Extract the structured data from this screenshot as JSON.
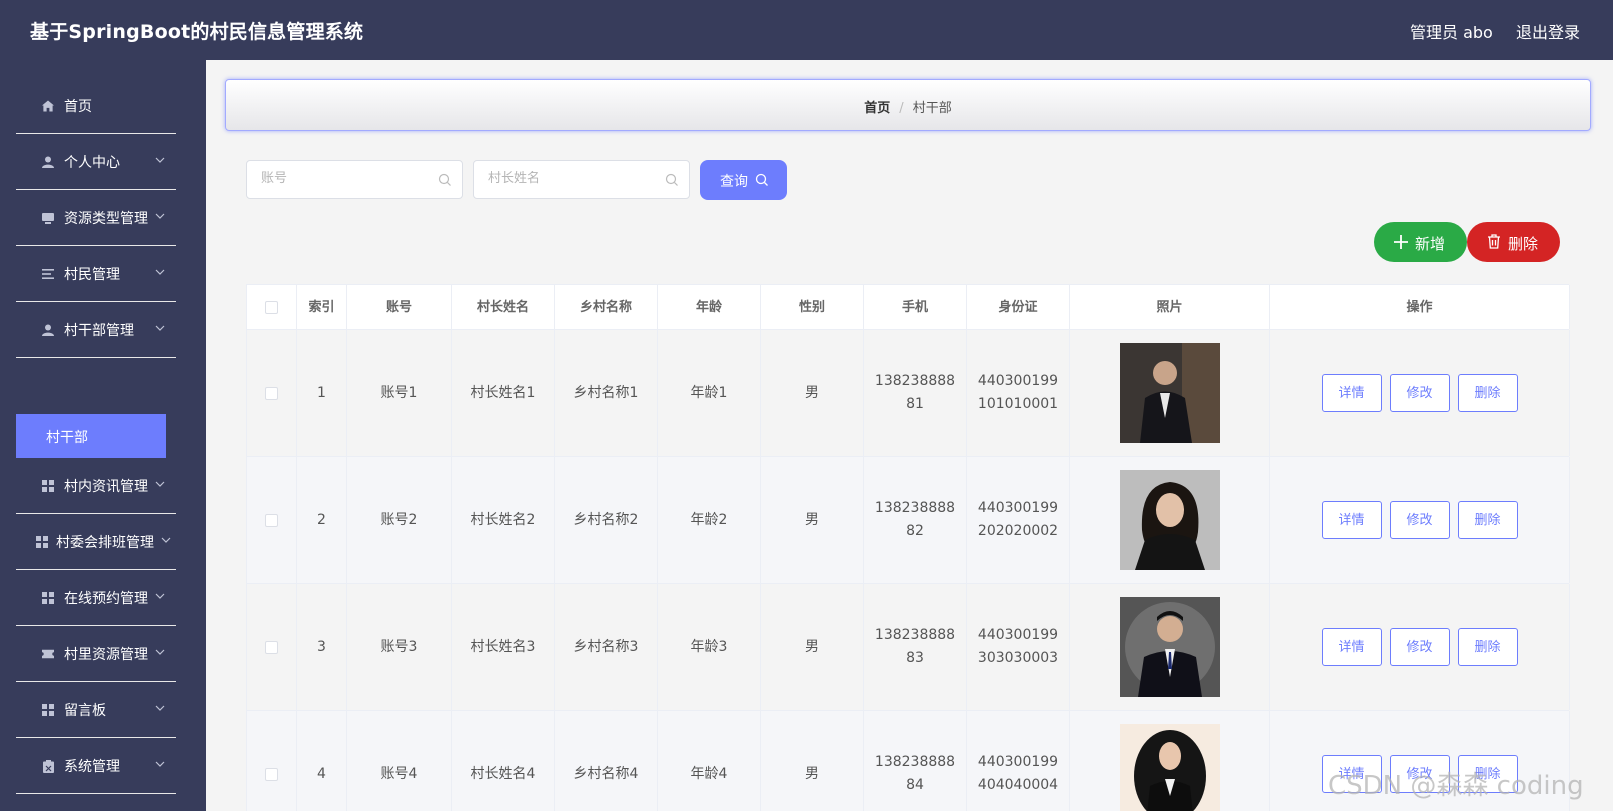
{
  "header": {
    "title": "基于SpringBoot的村民信息管理系统",
    "user": "管理员 abo",
    "logout": "退出登录"
  },
  "sidebar": {
    "items": [
      {
        "label": "首页",
        "icon": "home-icon"
      },
      {
        "label": "个人中心",
        "icon": "user-icon"
      },
      {
        "label": "资源类型管理",
        "icon": "drive-icon"
      },
      {
        "label": "村民管理",
        "icon": "list-icon"
      },
      {
        "label": "村干部管理",
        "icon": "user-icon"
      },
      {
        "label": "村内资讯管理",
        "icon": "grid-icon"
      },
      {
        "label": "村委会排班管理",
        "icon": "grid-icon"
      },
      {
        "label": "在线预约管理",
        "icon": "grid-icon"
      },
      {
        "label": "村里资源管理",
        "icon": "ticket-icon"
      },
      {
        "label": "留言板",
        "icon": "grid-icon"
      },
      {
        "label": "系统管理",
        "icon": "clipboard-icon"
      }
    ],
    "active_sub": "村干部"
  },
  "breadcrumb": {
    "home": "首页",
    "separator": "/",
    "current": "村干部"
  },
  "search": {
    "account_placeholder": "账号",
    "name_placeholder": "村长姓名",
    "query_label": "查询"
  },
  "actions": {
    "add_label": "新增",
    "delete_label": "删除"
  },
  "table": {
    "headers": [
      "索引",
      "账号",
      "村长姓名",
      "乡村名称",
      "年龄",
      "性别",
      "手机",
      "身份证",
      "照片",
      "操作"
    ],
    "op_labels": {
      "detail": "详情",
      "edit": "修改",
      "delete": "删除"
    },
    "rows": [
      {
        "index": "1",
        "account": "账号1",
        "name": "村长姓名1",
        "village": "乡村名称1",
        "age": "年龄1",
        "gender": "男",
        "phone_l1": "138238888",
        "phone_l2": "81",
        "id_l1": "440300199",
        "id_l2": "101010001"
      },
      {
        "index": "2",
        "account": "账号2",
        "name": "村长姓名2",
        "village": "乡村名称2",
        "age": "年龄2",
        "gender": "男",
        "phone_l1": "138238888",
        "phone_l2": "82",
        "id_l1": "440300199",
        "id_l2": "202020002"
      },
      {
        "index": "3",
        "account": "账号3",
        "name": "村长姓名3",
        "village": "乡村名称3",
        "age": "年龄3",
        "gender": "男",
        "phone_l1": "138238888",
        "phone_l2": "83",
        "id_l1": "440300199",
        "id_l2": "303030003"
      },
      {
        "index": "4",
        "account": "账号4",
        "name": "村长姓名4",
        "village": "乡村名称4",
        "age": "年龄4",
        "gender": "男",
        "phone_l1": "138238888",
        "phone_l2": "84",
        "id_l1": "440300199",
        "id_l2": "404040004"
      }
    ]
  },
  "watermark": "CSDN @森森 coding",
  "colors": {
    "header_bg": "#373c5b",
    "accent": "#6d7dfd",
    "add": "#2aaa46",
    "delete": "#d42424"
  }
}
